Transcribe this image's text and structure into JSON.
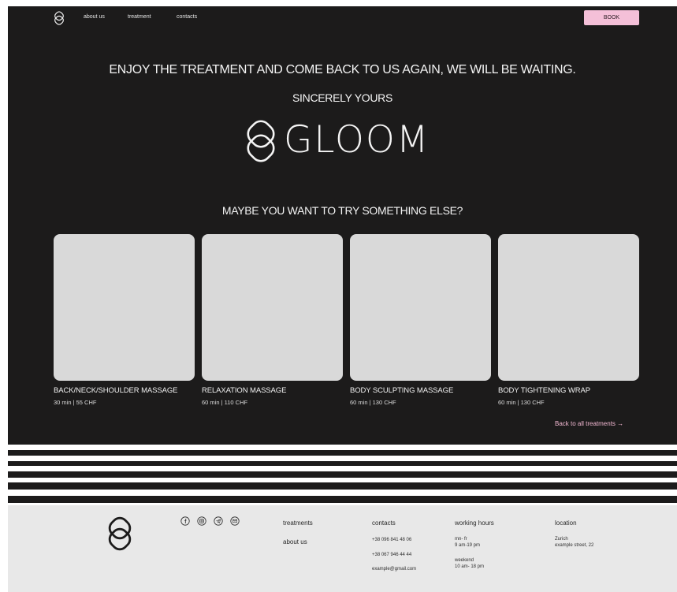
{
  "nav": {
    "links": [
      "about us",
      "treatment",
      "contacts"
    ],
    "book_label": "BOOK"
  },
  "hero": {
    "line1": "ENJOY THE TREATMENT AND COME BACK TO US AGAIN, WE WILL BE WAITING.",
    "line2": "SINCERELY YOURS",
    "brand": "GLOOM"
  },
  "suggestions": {
    "heading": "MAYBE YOU WANT TO TRY SOMETHING ELSE?",
    "cards": [
      {
        "name": "BACK/NECK/SHOULDER MASSAGE",
        "price": "30 min | 55 CHF"
      },
      {
        "name": "RELAXATION MASSAGE",
        "price": "60 min | 110 CHF"
      },
      {
        "name": "BODY SCULPTING MASSAGE",
        "price": "60 min | 130 CHF"
      },
      {
        "name": "BODY TIGHTENING WRAP",
        "price": "60 min | 130 CHF"
      }
    ],
    "back_link": "Back to all treatments →"
  },
  "footer": {
    "social_icons": [
      "facebook-icon",
      "instagram-icon",
      "telegram-icon",
      "mail-icon"
    ],
    "links": [
      "treatments",
      "about us"
    ],
    "contacts": {
      "title": "contacts",
      "phone1": "+38 096 841 48 06",
      "phone2": "+38 067 946 44 44",
      "email": "example@gmail.com"
    },
    "hours": {
      "title": "working hours",
      "weekdays": "mn- fr",
      "weekday_time": "9 am-19 pm",
      "weekend": "weekend",
      "weekend_time": "10 am- 18 pm"
    },
    "location": {
      "title": "location",
      "city": "Zurich",
      "street": "example street, 22"
    }
  },
  "colors": {
    "dark": "#1c1b1b",
    "accent_pink": "#f4c0d8",
    "card_placeholder": "#d9d9d9",
    "footer_bg": "#e8e8e8"
  }
}
